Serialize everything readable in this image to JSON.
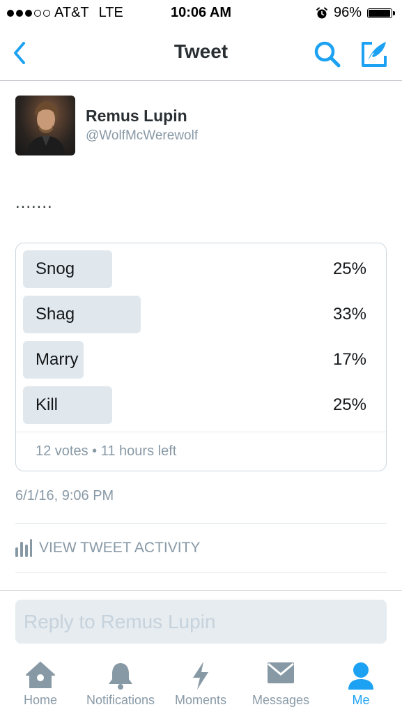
{
  "status_bar": {
    "carrier": "AT&T",
    "network": "LTE",
    "time": "10:06 AM",
    "battery": "96%",
    "signal_bars_filled": 3,
    "signal_bars_total": 5,
    "alarm_icon": "alarm-clock-icon",
    "battery_level": 0.96
  },
  "nav": {
    "title": "Tweet",
    "back_icon": "chevron-left-icon",
    "search_icon": "search-icon",
    "compose_icon": "compose-tweet-icon",
    "accent_color": "#1da1f2"
  },
  "tweet": {
    "author_name": "Remus Lupin",
    "author_handle": "@WolfMcWerewolf",
    "text": ".......",
    "timestamp": "6/1/16, 9:06 PM"
  },
  "poll": {
    "options": [
      {
        "label": "Snog",
        "percent": "25%",
        "value": 25
      },
      {
        "label": "Shag",
        "percent": "33%",
        "value": 33
      },
      {
        "label": "Marry",
        "percent": "17%",
        "value": 17
      },
      {
        "label": "Kill",
        "percent": "25%",
        "value": 25
      }
    ],
    "footer": "12 votes • 11 hours left"
  },
  "activity": {
    "label": "VIEW TWEET ACTIVITY",
    "icon": "bar-chart-icon"
  },
  "reply": {
    "placeholder": "Reply to Remus Lupin"
  },
  "tab_bar": {
    "tabs": [
      {
        "label": "Home",
        "icon": "home-icon"
      },
      {
        "label": "Notifications",
        "icon": "bell-icon"
      },
      {
        "label": "Moments",
        "icon": "lightning-icon"
      },
      {
        "label": "Messages",
        "icon": "envelope-icon"
      },
      {
        "label": "Me",
        "icon": "person-icon",
        "active": true
      }
    ],
    "inactive_color": "#8899a6",
    "active_color": "#1da1f2"
  }
}
